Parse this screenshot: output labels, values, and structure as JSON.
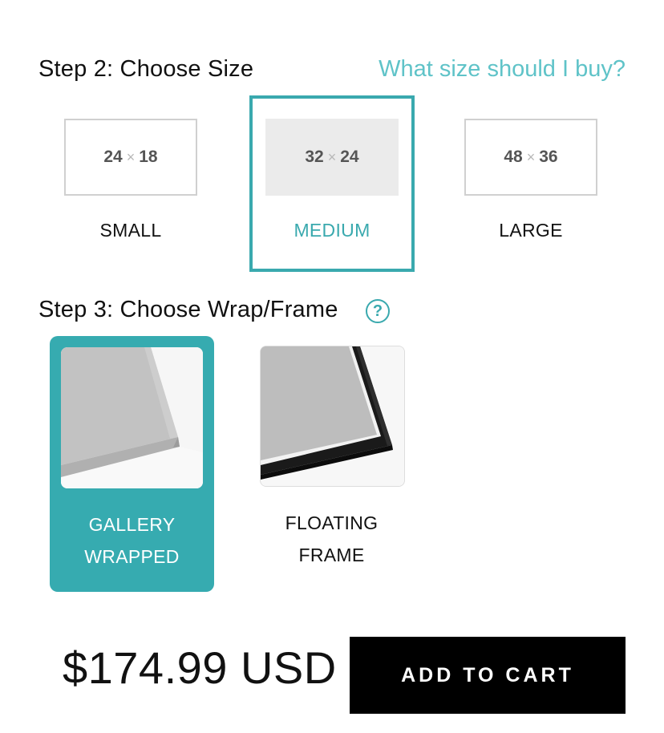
{
  "step2": {
    "title": "Step 2: Choose Size",
    "help_link": "What size should I buy?",
    "options": [
      {
        "w": "24",
        "sep": "×",
        "h": "18",
        "label": "SMALL"
      },
      {
        "w": "32",
        "sep": "×",
        "h": "24",
        "label": "MEDIUM",
        "selected": true
      },
      {
        "w": "48",
        "sep": "×",
        "h": "36",
        "label": "LARGE"
      }
    ]
  },
  "step3": {
    "title": "Step 3: Choose Wrap/Frame",
    "help_icon": "?",
    "options": [
      {
        "line1": "GALLERY",
        "line2": "WRAPPED",
        "selected": true
      },
      {
        "line1": "FLOATING",
        "line2": "FRAME"
      }
    ]
  },
  "price": "$174.99 USD",
  "cart_button": "ADD TO CART",
  "colors": {
    "accent": "#3aa9ae",
    "link": "#5fc3c8",
    "button": "#000000"
  }
}
